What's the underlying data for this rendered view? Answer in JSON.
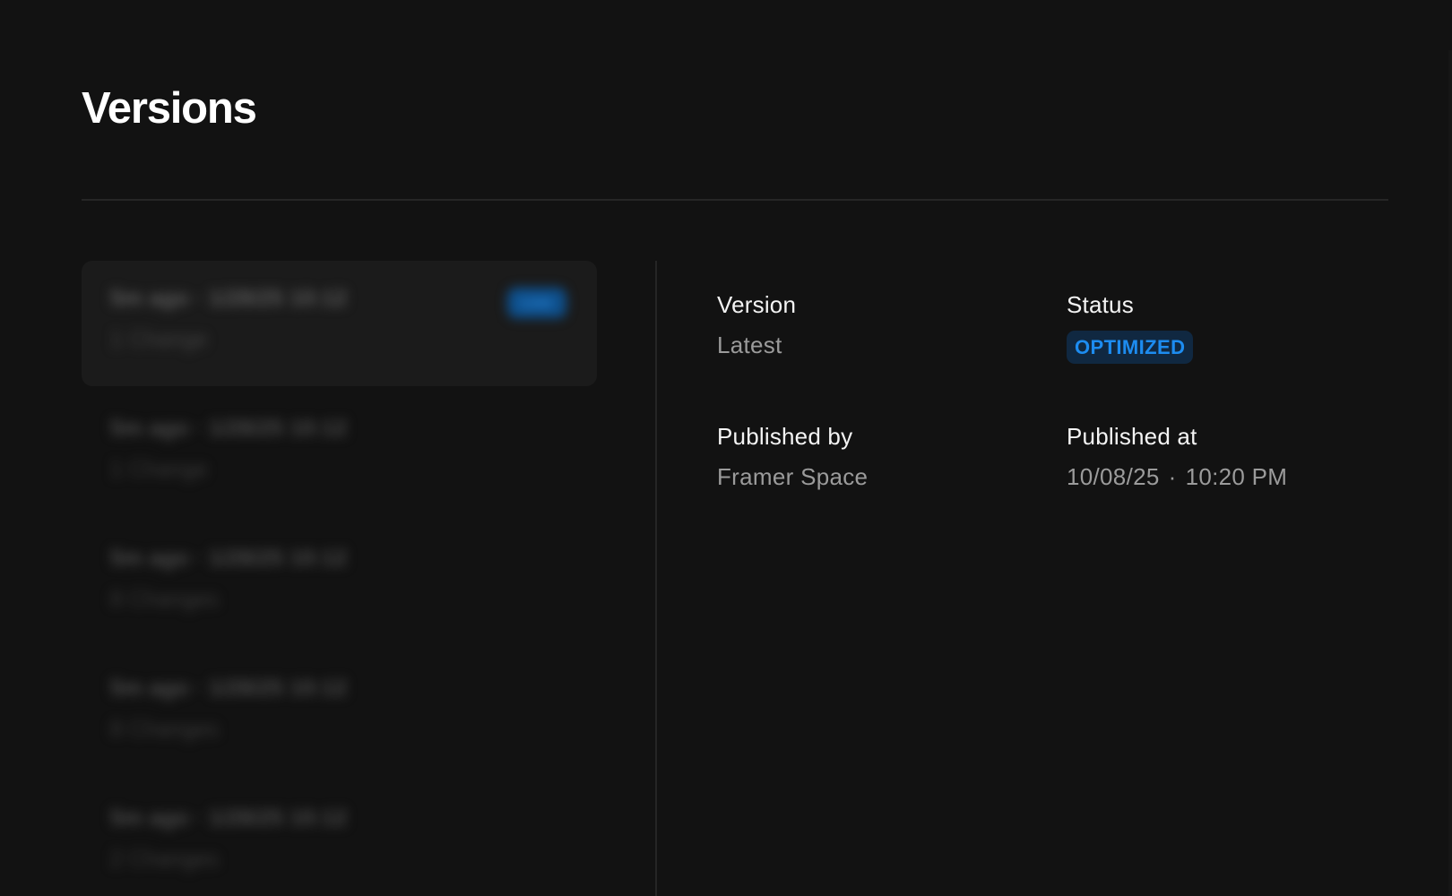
{
  "page": {
    "title": "Versions"
  },
  "versions_list": {
    "items": [
      {
        "title": "5m ago · 1/28/25 10:12",
        "changes": "1 Change",
        "badge": "Live",
        "selected": true
      },
      {
        "title": "5m ago · 1/28/25 10:12",
        "changes": "1 Change",
        "selected": false
      },
      {
        "title": "5m ago · 1/28/25 10:12",
        "changes": "8 Changes",
        "selected": false
      },
      {
        "title": "5m ago · 1/28/25 10:12",
        "changes": "8 Changes",
        "selected": false
      },
      {
        "title": "5m ago · 1/28/25 10:12",
        "changes": "2 Changes",
        "selected": false
      }
    ]
  },
  "details": {
    "version": {
      "label": "Version",
      "value": "Latest"
    },
    "status": {
      "label": "Status",
      "value": "OPTIMIZED",
      "color": "#1d8cf0"
    },
    "published_by": {
      "label": "Published by",
      "value": "Framer Space"
    },
    "published_at": {
      "label": "Published at",
      "date": "10/08/25",
      "separator": "·",
      "time": "10:20 PM"
    }
  },
  "colors": {
    "background": "#121212",
    "accent": "#1d8cf0"
  }
}
